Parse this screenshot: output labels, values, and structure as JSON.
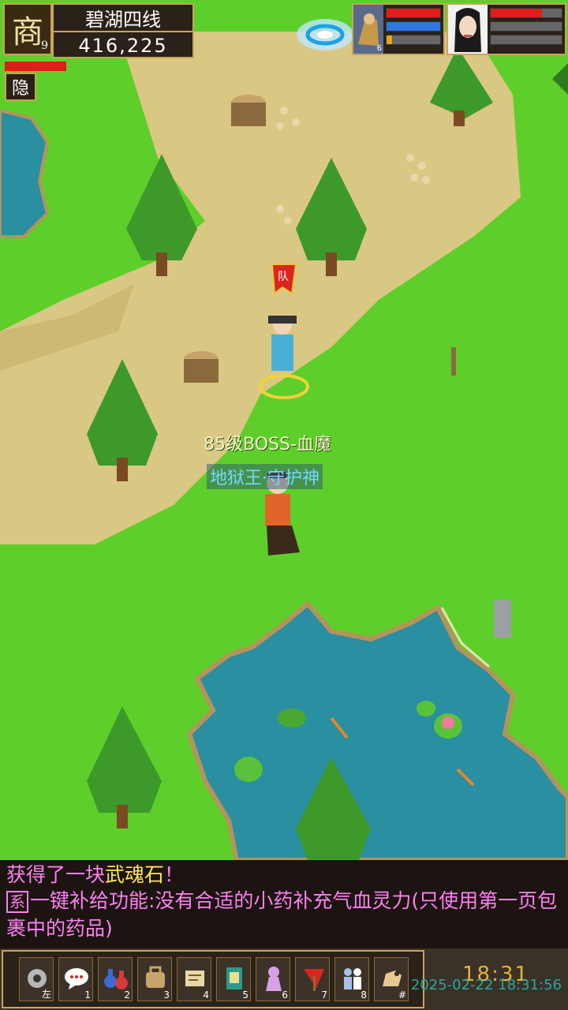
{
  "hud": {
    "minimap_glyph": "商",
    "minimap_level": "9",
    "zone_name": "碧湖四线",
    "coordinates": "416,225",
    "hide_button_label": "隐"
  },
  "party": [
    {
      "name": "party-member-1",
      "hp": 1.0,
      "mp": 1.0,
      "xp": 0.1,
      "number": "6"
    },
    {
      "name": "party-member-2",
      "hp": 0.72,
      "mp": 0.0,
      "xp": 0.0
    }
  ],
  "world": {
    "player_flag": "队",
    "boss_name": "85级BOSS-血魔",
    "boss_title": "地狱王·守护神"
  },
  "chat": {
    "line1_prefix": "获得了一块",
    "line1_item": "武魂石",
    "line1_suffix": "！",
    "line2_tag": "系",
    "line2_text": "一键补给功能:没有合适的小药补充气血灵力(只使用第一页包裹中的药品)"
  },
  "toolbar": {
    "slots": [
      {
        "icon": "settings-gear-icon",
        "key": "左"
      },
      {
        "icon": "chat-bubble-icon",
        "key": "1"
      },
      {
        "icon": "potion-bottle-icon",
        "key": "2"
      },
      {
        "icon": "backpack-icon",
        "key": "3"
      },
      {
        "icon": "scroll-map-icon",
        "key": "4"
      },
      {
        "icon": "spellbook-icon",
        "key": "5"
      },
      {
        "icon": "pet-figure-icon",
        "key": "6"
      },
      {
        "icon": "red-flag-icon",
        "key": "7"
      },
      {
        "icon": "team-figures-icon",
        "key": "8"
      },
      {
        "icon": "horse-mount-icon",
        "key": "#"
      }
    ]
  },
  "status": {
    "clock": "18:31",
    "timestamp": "2025-02-22 18:31:56"
  },
  "colors": {
    "grass": "#5ecf2a",
    "path": "#d9c784",
    "water": "#2a8fa0",
    "frame_gold": "#c9a55a",
    "chat_pink": "#ff7ff2",
    "chat_yellow": "#ffe54a"
  }
}
